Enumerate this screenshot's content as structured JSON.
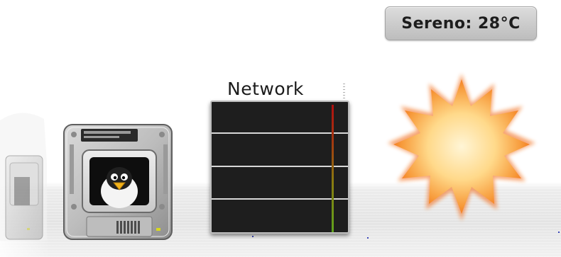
{
  "desktop": {
    "weather": {
      "city": "Sereno",
      "label": "Sereno: 28°C",
      "condition_icon": "sun-icon"
    },
    "network": {
      "title": "Network"
    },
    "icons": {
      "ghost_drive": "hard-drive-icon",
      "drive": "hard-drive-icon",
      "penguin": "penguin-icon"
    },
    "colors": {
      "graph_background": "#1e1e1e",
      "sun_core": "#ffd98a",
      "sun_edge": "#f26a12"
    }
  }
}
